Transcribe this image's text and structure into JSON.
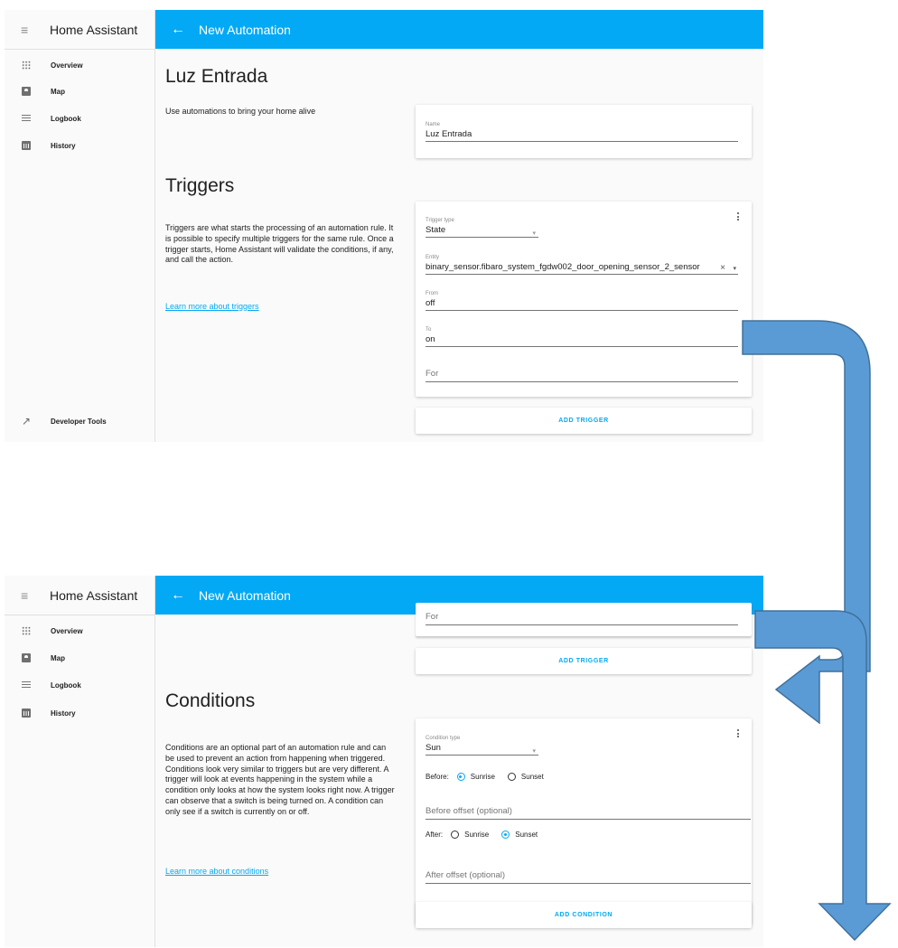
{
  "sidebar": {
    "title": "Home Assistant",
    "items": [
      {
        "label": "Overview",
        "icon": "grid-icon"
      },
      {
        "label": "Map",
        "icon": "map-icon"
      },
      {
        "label": "Logbook",
        "icon": "logbook-icon"
      },
      {
        "label": "History",
        "icon": "history-icon"
      }
    ],
    "developer_tools": {
      "label": "Developer Tools",
      "icon": "hammer-icon"
    }
  },
  "topbar": {
    "title": "New Automation",
    "back_icon": "arrow-back-icon"
  },
  "colors": {
    "accent": "#03a9f4",
    "arrow": "#5b9bd5",
    "arrow_outline": "#41719c"
  },
  "automation": {
    "title": "Luz Entrada",
    "description": "Use automations to bring your home alive",
    "name_label": "Name",
    "name_value": "Luz Entrada"
  },
  "triggers": {
    "title": "Triggers",
    "description": "Triggers are what starts the processing of an automation rule. It is possible to specify multiple triggers for the same rule. Once a trigger starts, Home Assistant will validate the conditions, if any, and call the action.",
    "link": "Learn more about triggers",
    "type_label": "Trigger type",
    "type_value": "State",
    "entity_label": "Entity",
    "entity_value": "binary_sensor.fibaro_system_fgdw002_door_opening_sensor_2_sensor",
    "from_label": "From",
    "from_value": "off",
    "to_label": "To",
    "to_value": "on",
    "for_placeholder": "For",
    "add_button": "ADD TRIGGER"
  },
  "conditions": {
    "title": "Conditions",
    "description": "Conditions are an optional part of an automation rule and can be used to prevent an action from happening when triggered. Conditions look very similar to triggers but are very different. A trigger will look at events happening in the system while a condition only looks at how the system looks right now. A trigger can observe that a switch is being turned on. A condition can only see if a switch is currently on or off.",
    "link": "Learn more about conditions",
    "type_label": "Condition type",
    "type_value": "Sun",
    "before_label": "Before:",
    "after_label": "After:",
    "sunrise": "Sunrise",
    "sunset": "Sunset",
    "before_selected": "Sunrise",
    "after_selected": "Sunset",
    "before_offset_placeholder": "Before offset (optional)",
    "after_offset_placeholder": "After offset (optional)",
    "add_button": "ADD CONDITION"
  }
}
